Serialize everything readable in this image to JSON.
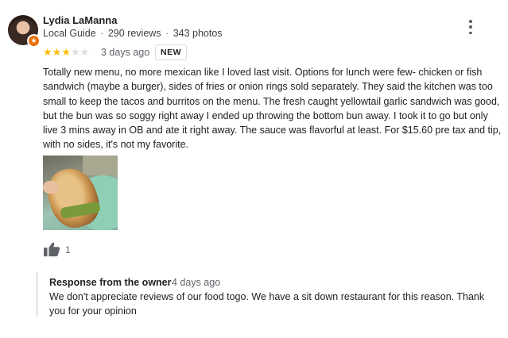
{
  "reviewer": {
    "name": "Lydia LaManna",
    "badge": "Local Guide",
    "reviews": "290 reviews",
    "photos": "343 photos",
    "separator": "·"
  },
  "rating": {
    "stars": 3,
    "max": 5,
    "color": "#fbbc04"
  },
  "review": {
    "date": "3 days ago",
    "new_label": "NEW",
    "text": "Totally new menu, no more mexican like I loved last visit. Options for lunch were few- chicken or fish sandwich (maybe a burger), sides of fries or onion rings sold separately. They said the kitchen was too small to keep the tacos and burritos on the menu. The fresh caught yellowtail garlic sandwich was good, but the bun was so soggy right away I ended up throwing the bottom bun away. I took it to go but only live 3 mins away in OB and ate it right away. The sauce was flavorful at least. For $15.60 pre tax and tip, with no sides, it's not my favorite.",
    "likes": "1"
  },
  "owner_response": {
    "title": "Response from the owner",
    "date": "4 days ago",
    "text": "We don't appreciate reviews of our food togo. We have a sit down restaurant for this reason. Thank you for your opinion"
  },
  "icons": {
    "more": "more-vert-icon",
    "like": "thumb-up-icon",
    "guide": "local-guide-star-icon"
  }
}
